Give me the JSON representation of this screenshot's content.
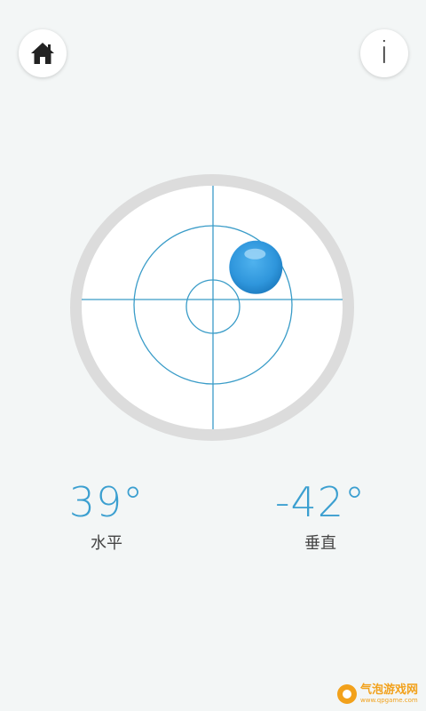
{
  "colors": {
    "background": "#f3f6f6",
    "accent": "#3b9fd0",
    "crosshair": "#3a9cc8",
    "bubble": "#2f96dc",
    "bezel": "#dcdcdc",
    "watermark": "#f2a11b"
  },
  "toolbar": {
    "home_icon": "home-icon",
    "info_label": "i"
  },
  "level": {
    "bubble_offset": {
      "x": 0.36,
      "y": -0.33
    }
  },
  "readouts": {
    "horizontal": {
      "value": "39°",
      "label": "水平"
    },
    "vertical": {
      "value": "-42°",
      "label": "垂直"
    }
  },
  "watermark": {
    "title": "气泡游戏网",
    "url": "www.qpgame.com"
  }
}
